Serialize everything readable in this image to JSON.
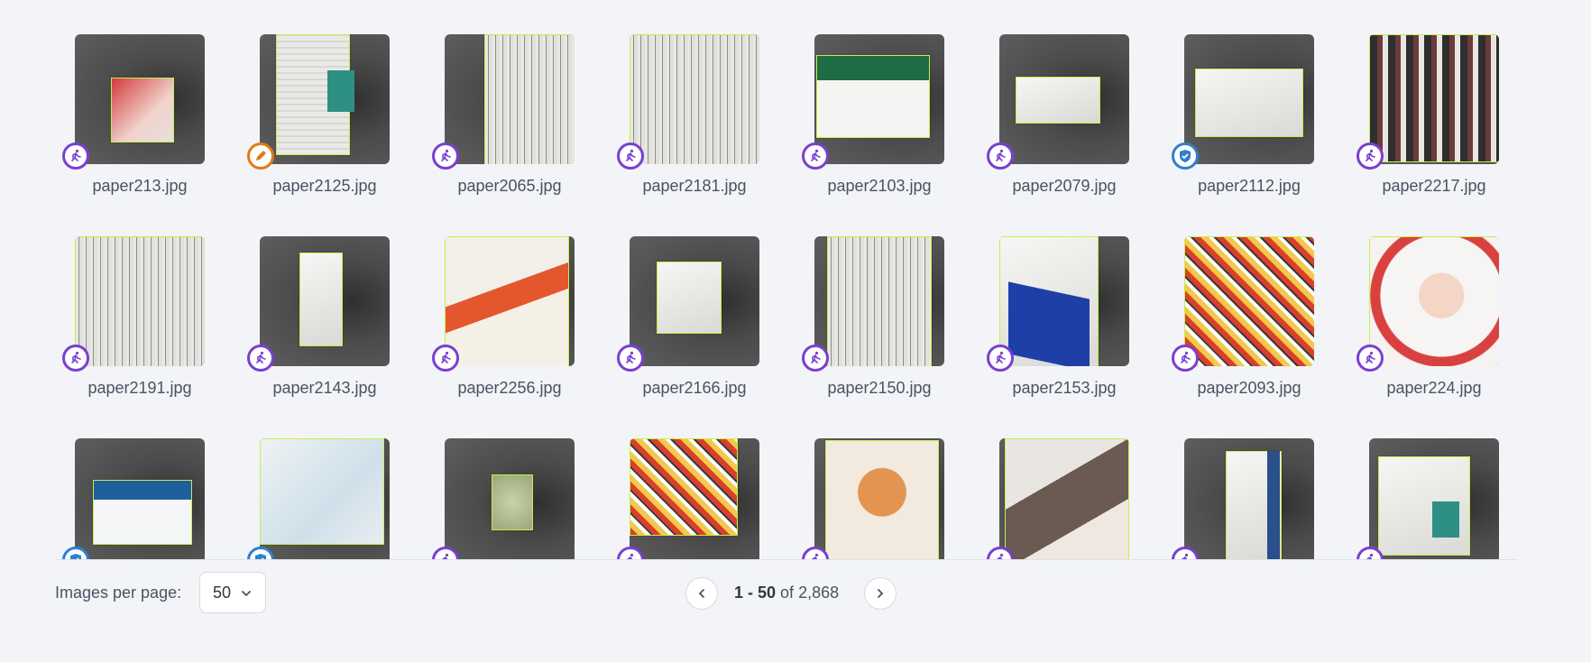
{
  "grid": {
    "items": [
      {
        "file": "paper213.jpg",
        "badge": "inspect",
        "icon": "runner-icon"
      },
      {
        "file": "paper2125.jpg",
        "badge": "edit",
        "icon": "pen-icon"
      },
      {
        "file": "paper2065.jpg",
        "badge": "inspect",
        "icon": "runner-icon"
      },
      {
        "file": "paper2181.jpg",
        "badge": "inspect",
        "icon": "runner-icon"
      },
      {
        "file": "paper2103.jpg",
        "badge": "inspect",
        "icon": "runner-icon"
      },
      {
        "file": "paper2079.jpg",
        "badge": "inspect",
        "icon": "runner-icon"
      },
      {
        "file": "paper2112.jpg",
        "badge": "verify",
        "icon": "shield-check-icon"
      },
      {
        "file": "paper2217.jpg",
        "badge": "inspect",
        "icon": "runner-icon"
      },
      {
        "file": "paper2191.jpg",
        "badge": "inspect",
        "icon": "runner-icon"
      },
      {
        "file": "paper2143.jpg",
        "badge": "inspect",
        "icon": "runner-icon"
      },
      {
        "file": "paper2256.jpg",
        "badge": "inspect",
        "icon": "runner-icon"
      },
      {
        "file": "paper2166.jpg",
        "badge": "inspect",
        "icon": "runner-icon"
      },
      {
        "file": "paper2150.jpg",
        "badge": "inspect",
        "icon": "runner-icon"
      },
      {
        "file": "paper2153.jpg",
        "badge": "inspect",
        "icon": "runner-icon"
      },
      {
        "file": "paper2093.jpg",
        "badge": "inspect",
        "icon": "runner-icon"
      },
      {
        "file": "paper224.jpg",
        "badge": "inspect",
        "icon": "runner-icon"
      },
      {
        "file": "",
        "badge": "verify",
        "icon": "shield-check-icon"
      },
      {
        "file": "",
        "badge": "verify",
        "icon": "shield-check-icon"
      },
      {
        "file": "",
        "badge": "inspect",
        "icon": "runner-icon"
      },
      {
        "file": "",
        "badge": "inspect",
        "icon": "runner-icon"
      },
      {
        "file": "",
        "badge": "inspect",
        "icon": "runner-icon"
      },
      {
        "file": "",
        "badge": "inspect",
        "icon": "runner-icon"
      },
      {
        "file": "",
        "badge": "inspect",
        "icon": "runner-icon"
      },
      {
        "file": "",
        "badge": "inspect",
        "icon": "runner-icon"
      }
    ]
  },
  "footer": {
    "per_page_label": "Images per page:",
    "per_page_value": "50",
    "range_start_end": "1 - 50",
    "range_of": "of",
    "total": "2,868"
  },
  "colors": {
    "inspect": "#7a3fd0",
    "edit": "#e07b17",
    "verify": "#2f7fd0",
    "outline": "#c7ef4a"
  }
}
